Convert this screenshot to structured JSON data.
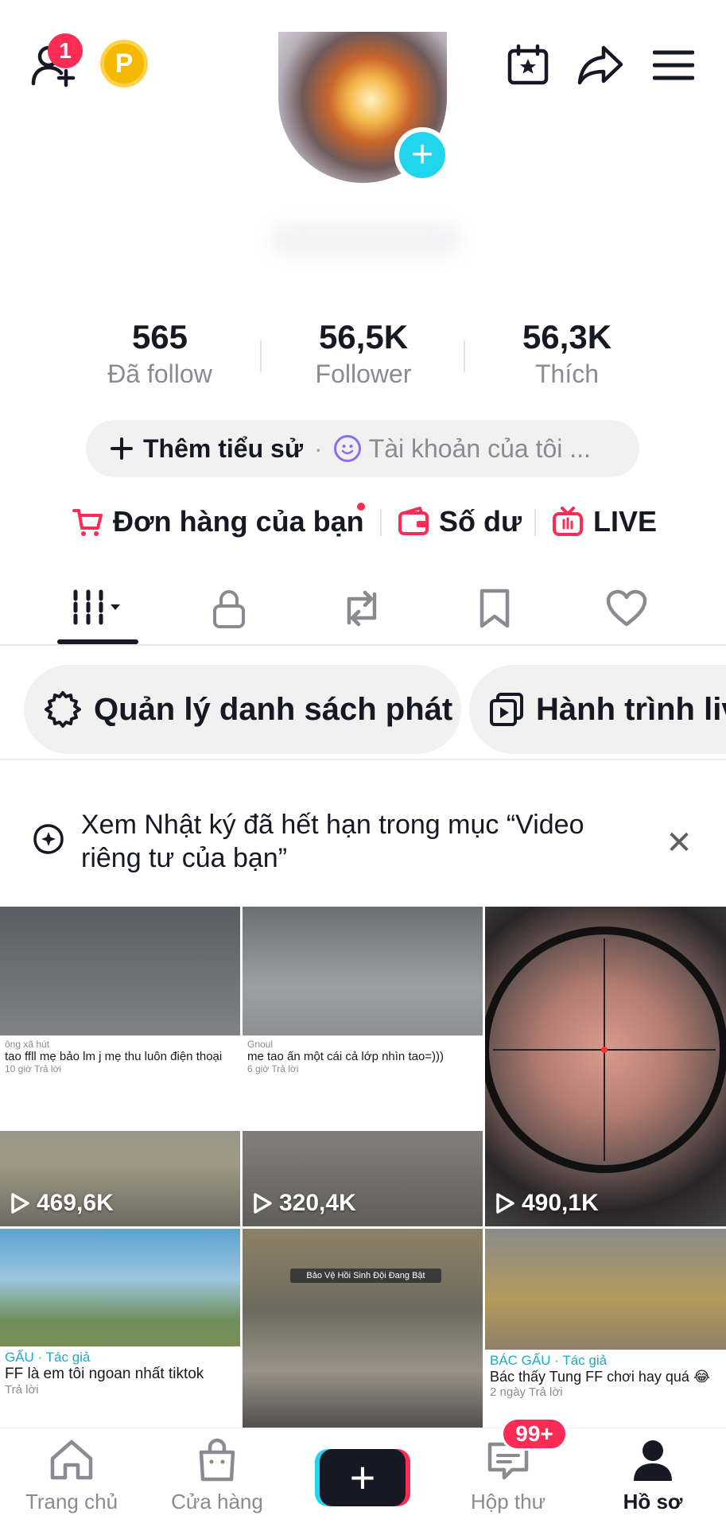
{
  "header": {
    "friend_requests_badge": "1",
    "coin_label": "P"
  },
  "stats": [
    {
      "value": "565",
      "label": "Đã follow"
    },
    {
      "value": "56,5K",
      "label": "Follower"
    },
    {
      "value": "56,3K",
      "label": "Thích"
    }
  ],
  "bio": {
    "add_label": "Thêm tiểu sử",
    "separator": "·",
    "account_label": "Tài khoản của tôi ..."
  },
  "quick_links": {
    "orders": "Đơn hàng của bạn",
    "balance": "Số dư",
    "live": "LIVE"
  },
  "chips": {
    "playlist": "Quản lý danh sách phát",
    "live_journey": "Hành trình liv"
  },
  "notice": {
    "text": "Xem Nhật ký đã hết hạn trong mục “Video riêng tư của bạn”",
    "close": "✕"
  },
  "videos": [
    {
      "views": "469,6K",
      "comment": {
        "user": "ông xã hút",
        "text": "tao ffll mẹ bảo lm j mẹ thu luôn điện thoại",
        "meta": "10 giờ   Trả lời"
      }
    },
    {
      "views": "320,4K",
      "comment": {
        "user": "Gnoul",
        "text": "me tao ấn một cái cả lớp nhìn tao=)))",
        "meta": "6 giờ   Trả lời"
      }
    },
    {
      "views": "490,1K",
      "comment": null
    },
    {
      "views": "",
      "comment": {
        "user": "GẤU · Tác giả",
        "text": "FF là em tôi ngoan nhất tiktok",
        "meta": "Trả lời"
      }
    },
    {
      "views": "",
      "comment": null,
      "overlay": "Bảo Vệ Hồi Sinh Đội Đang Bật"
    },
    {
      "views": "",
      "comment": {
        "user": "BÁC GẤU · Tác giả",
        "text": "Bác thấy Tung FF chơi hay quá 😂",
        "meta": "2 ngày   Trả lời"
      }
    }
  ],
  "bottom_nav": {
    "home": "Trang chủ",
    "shop": "Cửa hàng",
    "create": "+",
    "inbox": "Hộp thư",
    "inbox_badge": "99+",
    "profile": "Hồ sơ"
  },
  "colors": {
    "accent_red": "#fe2c55",
    "accent_cyan": "#20d5ec",
    "text_primary": "#161823",
    "text_secondary": "#8a8b91"
  }
}
